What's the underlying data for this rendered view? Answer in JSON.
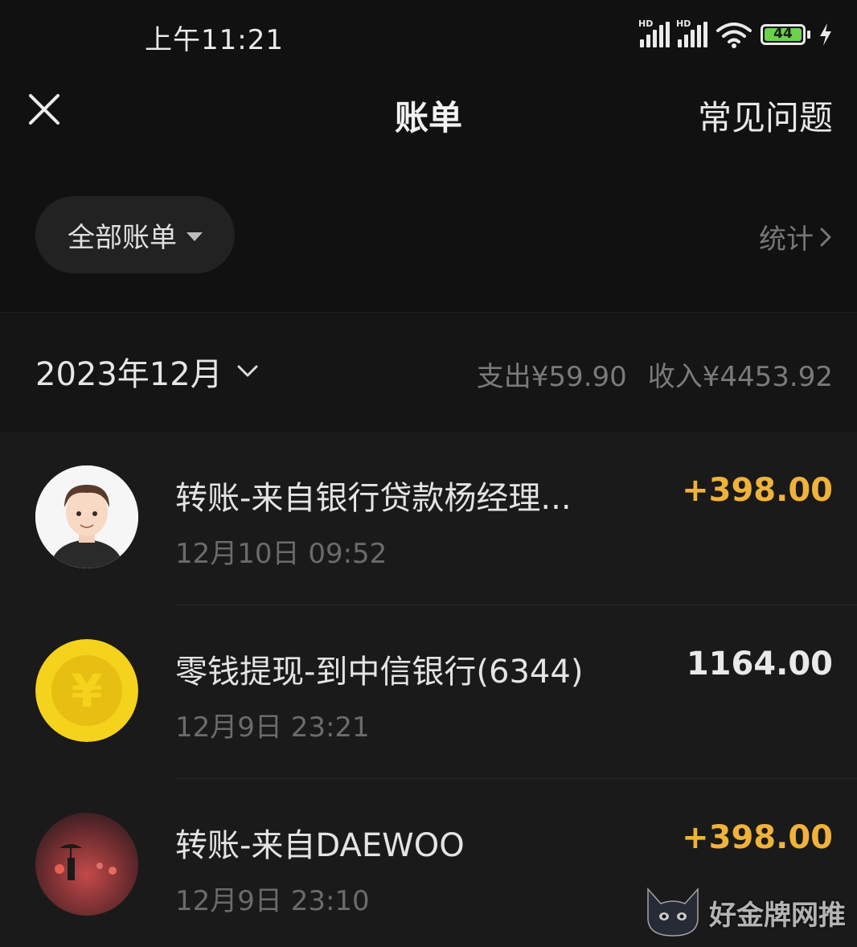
{
  "status_bar": {
    "time": "上午11:21",
    "signal_1_label": "HD",
    "signal_2_label": "HD",
    "battery_level": "44"
  },
  "header": {
    "title": "账单",
    "faq_label": "常见问题",
    "close_icon": "close-icon"
  },
  "filter": {
    "selected": "全部账单",
    "stats_label": "统计"
  },
  "month": {
    "label": "2023年12月",
    "expense": "支出¥59.90",
    "income": "收入¥4453.92"
  },
  "transactions": [
    {
      "title": "转账-来自银行贷款杨经理...",
      "time": "12月10日 09:52",
      "amount": "+398.00",
      "icon": "cartoon-avatar"
    },
    {
      "title": "零钱提现-到中信银行(6344)",
      "time": "12月9日 23:21",
      "amount": "1164.00",
      "icon": "yuan-coin-icon"
    },
    {
      "title": "转账-来自DAEWOO",
      "time": "12月9日 23:10",
      "amount": "+398.00",
      "icon": "rainy-street-avatar"
    }
  ],
  "watermark": {
    "text": "好金牌网推"
  },
  "colors": {
    "background": "#111111",
    "list_background": "#1a1a1a",
    "income_amount": "#f0b23a",
    "coin_yellow": "#f5d21c",
    "battery_green": "#6ad24c"
  }
}
